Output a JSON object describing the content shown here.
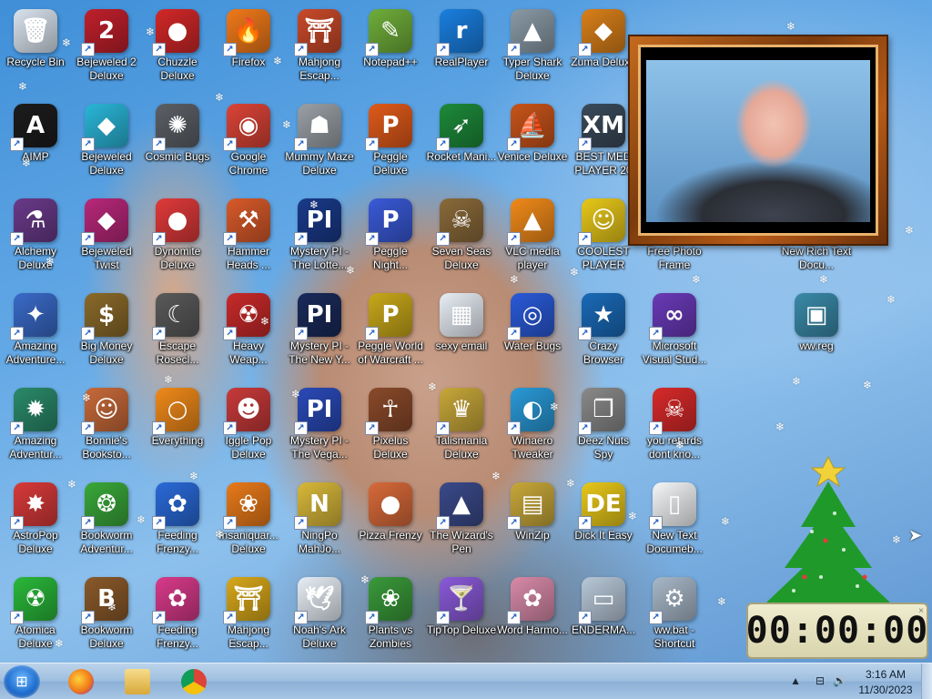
{
  "desktop": {
    "icons": [
      {
        "label": "Recycle Bin",
        "glyph": "🗑",
        "color": "#d9e3ee",
        "shortcut": false,
        "col": 0,
        "row": 0
      },
      {
        "label": "Bejeweled 2 Deluxe",
        "glyph": "2",
        "color": "#c0202c",
        "shortcut": true,
        "col": 1,
        "row": 0
      },
      {
        "label": "Chuzzle Deluxe",
        "glyph": "●",
        "color": "#d22828",
        "shortcut": true,
        "col": 2,
        "row": 0
      },
      {
        "label": "Firefox",
        "glyph": "🔥",
        "color": "#f07a1a",
        "shortcut": true,
        "col": 3,
        "row": 0
      },
      {
        "label": "Mahjong Escap...",
        "glyph": "⛩",
        "color": "#c94a2a",
        "shortcut": true,
        "col": 4,
        "row": 0
      },
      {
        "label": "Notepad++",
        "glyph": "✎",
        "color": "#6fae3a",
        "shortcut": true,
        "col": 5,
        "row": 0
      },
      {
        "label": "RealPlayer",
        "glyph": "r",
        "color": "#1a7fe0",
        "shortcut": true,
        "col": 6,
        "row": 0
      },
      {
        "label": "Typer Shark Deluxe",
        "glyph": "▲",
        "color": "#8a9aa6",
        "shortcut": true,
        "col": 7,
        "row": 0
      },
      {
        "label": "Zuma Deluxe",
        "glyph": "◆",
        "color": "#d9801a",
        "shortcut": true,
        "col": 8,
        "row": 0
      },
      {
        "label": "AIMP",
        "glyph": "A",
        "color": "#1c1c1c",
        "shortcut": true,
        "col": 0,
        "row": 1
      },
      {
        "label": "Bejeweled Deluxe",
        "glyph": "◆",
        "color": "#2ab6d8",
        "shortcut": true,
        "col": 1,
        "row": 1
      },
      {
        "label": "Cosmic Bugs",
        "glyph": "✺",
        "color": "#5c6066",
        "shortcut": true,
        "col": 2,
        "row": 1
      },
      {
        "label": "Google Chrome",
        "glyph": "◉",
        "color": "#db4437",
        "shortcut": true,
        "col": 3,
        "row": 1
      },
      {
        "label": "Mummy Maze Deluxe",
        "glyph": "☗",
        "color": "#9aa0a6",
        "shortcut": true,
        "col": 4,
        "row": 1
      },
      {
        "label": "Peggle Deluxe",
        "glyph": "P",
        "color": "#e05a1a",
        "shortcut": true,
        "col": 5,
        "row": 1
      },
      {
        "label": "Rocket Mani...",
        "glyph": "➶",
        "color": "#1d8a3a",
        "shortcut": true,
        "col": 6,
        "row": 1
      },
      {
        "label": "Venice Deluxe",
        "glyph": "⛵",
        "color": "#c8541a",
        "shortcut": true,
        "col": 7,
        "row": 1
      },
      {
        "label": "BEST MED PLAYER 20",
        "glyph": "XM",
        "color": "#3a4a5a",
        "shortcut": true,
        "col": 8,
        "row": 1
      },
      {
        "label": "Alchemy Deluxe",
        "glyph": "⚗",
        "color": "#6a3a8a",
        "shortcut": true,
        "col": 0,
        "row": 2
      },
      {
        "label": "Bejeweled Twist",
        "glyph": "◆",
        "color": "#b8287a",
        "shortcut": true,
        "col": 1,
        "row": 2
      },
      {
        "label": "Dynomite Deluxe",
        "glyph": "●",
        "color": "#e03a3a",
        "shortcut": true,
        "col": 2,
        "row": 2
      },
      {
        "label": "Hammer Heads ...",
        "glyph": "⚒",
        "color": "#d85a2a",
        "shortcut": true,
        "col": 3,
        "row": 2
      },
      {
        "label": "Mystery PI - The Lotte...",
        "glyph": "PI",
        "color": "#1a3a8a",
        "shortcut": true,
        "col": 4,
        "row": 2
      },
      {
        "label": "Peggle Night...",
        "glyph": "P",
        "color": "#3a5ad8",
        "shortcut": true,
        "col": 5,
        "row": 2
      },
      {
        "label": "Seven Seas Deluxe",
        "glyph": "☠",
        "color": "#8a6a3a",
        "shortcut": true,
        "col": 6,
        "row": 2
      },
      {
        "label": "VLC media player",
        "glyph": "▲",
        "color": "#f08a1a",
        "shortcut": true,
        "col": 7,
        "row": 2
      },
      {
        "label": "COOLEST PLAYER",
        "glyph": "☺",
        "color": "#e8c81a",
        "shortcut": true,
        "col": 8,
        "row": 2
      },
      {
        "label": "Amazing Adventure...",
        "glyph": "✦",
        "color": "#3a6ac8",
        "shortcut": true,
        "col": 0,
        "row": 3
      },
      {
        "label": "Big Money Deluxe",
        "glyph": "$",
        "color": "#8a6a2a",
        "shortcut": true,
        "col": 1,
        "row": 3
      },
      {
        "label": "Escape Rosecl...",
        "glyph": "☾",
        "color": "#5a5a5a",
        "shortcut": true,
        "col": 2,
        "row": 3
      },
      {
        "label": "Heavy Weap...",
        "glyph": "☢",
        "color": "#c82a2a",
        "shortcut": true,
        "col": 3,
        "row": 3
      },
      {
        "label": "Mystery PI - The New Y...",
        "glyph": "PI",
        "color": "#1a2a5a",
        "shortcut": true,
        "col": 4,
        "row": 3
      },
      {
        "label": "Peggle World of Warcraft ...",
        "glyph": "P",
        "color": "#c8a81a",
        "shortcut": true,
        "col": 5,
        "row": 3
      },
      {
        "label": "sexy email",
        "glyph": "▦",
        "color": "#e8eef6",
        "shortcut": false,
        "col": 6,
        "row": 3
      },
      {
        "label": "Water Bugs",
        "glyph": "◎",
        "color": "#2a5ad8",
        "shortcut": true,
        "col": 7,
        "row": 3
      },
      {
        "label": "Crazy Browser",
        "glyph": "★",
        "color": "#1a6ab8",
        "shortcut": true,
        "col": 8,
        "row": 3
      },
      {
        "label": "Microsoft Visual Stud...",
        "glyph": "∞",
        "color": "#6a3ab8",
        "shortcut": true,
        "col": 9,
        "row": 3
      },
      {
        "label": "ww.reg",
        "glyph": "▣",
        "color": "#3a8aa8",
        "shortcut": false,
        "col": 11,
        "row": 3
      },
      {
        "label": "Amazing Adventur...",
        "glyph": "✹",
        "color": "#2a8a6a",
        "shortcut": true,
        "col": 0,
        "row": 4
      },
      {
        "label": "Bonnie's Booksto...",
        "glyph": "☺",
        "color": "#c86a3a",
        "shortcut": true,
        "col": 1,
        "row": 4
      },
      {
        "label": "Everything",
        "glyph": "○",
        "color": "#f08a1a",
        "shortcut": true,
        "col": 2,
        "row": 4
      },
      {
        "label": "Iggle Pop Deluxe",
        "glyph": "☻",
        "color": "#c83a3a",
        "shortcut": true,
        "col": 3,
        "row": 4
      },
      {
        "label": "Mystery PI - The Vega...",
        "glyph": "PI",
        "color": "#2a4ab8",
        "shortcut": true,
        "col": 4,
        "row": 4
      },
      {
        "label": "Pixelus Deluxe",
        "glyph": "☥",
        "color": "#8a4a2a",
        "shortcut": true,
        "col": 5,
        "row": 4
      },
      {
        "label": "Talismania Deluxe",
        "glyph": "♛",
        "color": "#c8a83a",
        "shortcut": true,
        "col": 6,
        "row": 4
      },
      {
        "label": "Winaero Tweaker",
        "glyph": "◐",
        "color": "#2a9ad8",
        "shortcut": true,
        "col": 7,
        "row": 4
      },
      {
        "label": "Deez Nuts Spy",
        "glyph": "❐",
        "color": "#8a8a8a",
        "shortcut": true,
        "col": 8,
        "row": 4
      },
      {
        "label": "you retards dont kno...",
        "glyph": "☠",
        "color": "#d82a2a",
        "shortcut": true,
        "col": 9,
        "row": 4
      },
      {
        "label": "AstroPop Deluxe",
        "glyph": "✸",
        "color": "#d83a3a",
        "shortcut": true,
        "col": 0,
        "row": 5
      },
      {
        "label": "Bookworm Adventur...",
        "glyph": "❂",
        "color": "#3aa83a",
        "shortcut": true,
        "col": 1,
        "row": 5
      },
      {
        "label": "Feeding Frenzy...",
        "glyph": "✿",
        "color": "#2a6ad8",
        "shortcut": true,
        "col": 2,
        "row": 5
      },
      {
        "label": "Insaniquar... Deluxe",
        "glyph": "❀",
        "color": "#e87a1a",
        "shortcut": true,
        "col": 3,
        "row": 5
      },
      {
        "label": "NingPo MahJo...",
        "glyph": "N",
        "color": "#d8b83a",
        "shortcut": true,
        "col": 4,
        "row": 5
      },
      {
        "label": "Pizza Frenzy",
        "glyph": "●",
        "color": "#d86a3a",
        "shortcut": false,
        "col": 5,
        "row": 5
      },
      {
        "label": "The Wizard's Pen",
        "glyph": "▲",
        "color": "#3a4a8a",
        "shortcut": true,
        "col": 6,
        "row": 5
      },
      {
        "label": "WinZip",
        "glyph": "▤",
        "color": "#c8a83a",
        "shortcut": true,
        "col": 7,
        "row": 5
      },
      {
        "label": "Dick It Easy",
        "glyph": "DE",
        "color": "#e8c81a",
        "shortcut": true,
        "col": 8,
        "row": 5
      },
      {
        "label": "New Text Documeb...",
        "glyph": "▯",
        "color": "#f4f6f8",
        "shortcut": true,
        "col": 9,
        "row": 5
      },
      {
        "label": "Atomica Deluxe",
        "glyph": "☢",
        "color": "#2ab83a",
        "shortcut": true,
        "col": 0,
        "row": 6
      },
      {
        "label": "Bookworm Deluxe",
        "glyph": "B",
        "color": "#8a5a2a",
        "shortcut": true,
        "col": 1,
        "row": 6
      },
      {
        "label": "Feeding Frenzy...",
        "glyph": "✿",
        "color": "#d83a8a",
        "shortcut": true,
        "col": 2,
        "row": 6
      },
      {
        "label": "Mahjong Escap...",
        "glyph": "⛩",
        "color": "#d8a81a",
        "shortcut": true,
        "col": 3,
        "row": 6
      },
      {
        "label": "Noah's Ark Deluxe",
        "glyph": "🕊",
        "color": "#e8eef6",
        "shortcut": true,
        "col": 4,
        "row": 6
      },
      {
        "label": "Plants vs Zombies",
        "glyph": "❀",
        "color": "#3a9a3a",
        "shortcut": true,
        "col": 5,
        "row": 6
      },
      {
        "label": "TipTop Deluxe",
        "glyph": "🍸",
        "color": "#8a5ad8",
        "shortcut": true,
        "col": 6,
        "row": 6
      },
      {
        "label": "Word Harmo...",
        "glyph": "✿",
        "color": "#d88aa8",
        "shortcut": true,
        "col": 7,
        "row": 6
      },
      {
        "label": "ENDERMA...",
        "glyph": "▭",
        "color": "#b8c8d8",
        "shortcut": true,
        "col": 8,
        "row": 6
      },
      {
        "label": "ww.bat - Shortcut",
        "glyph": "⚙",
        "color": "#a8b8c8",
        "shortcut": true,
        "col": 9,
        "row": 6
      },
      {
        "label": "Free Photo Frame",
        "glyph": "▭",
        "color": "#c8d8e8",
        "shortcut": false,
        "col": 9,
        "row": 2
      },
      {
        "label": "New Rich Text Docu...",
        "glyph": "▯",
        "color": "#f4f6f8",
        "shortcut": false,
        "col": 11,
        "row": 2
      }
    ]
  },
  "clock_widget": {
    "display": "00:00:00",
    "close_label": "×"
  },
  "taskbar": {
    "start_label": "⊞",
    "pinned": [
      {
        "name": "Firefox",
        "color": "#f07a1a"
      },
      {
        "name": "Explorer",
        "color": "#e8c86a"
      },
      {
        "name": "Chrome",
        "color": "#db4437"
      }
    ],
    "tray": {
      "arrow": "▲",
      "network": "⊟",
      "volume": "🔊"
    },
    "time": "3:16 AM",
    "date": "11/30/2023"
  }
}
